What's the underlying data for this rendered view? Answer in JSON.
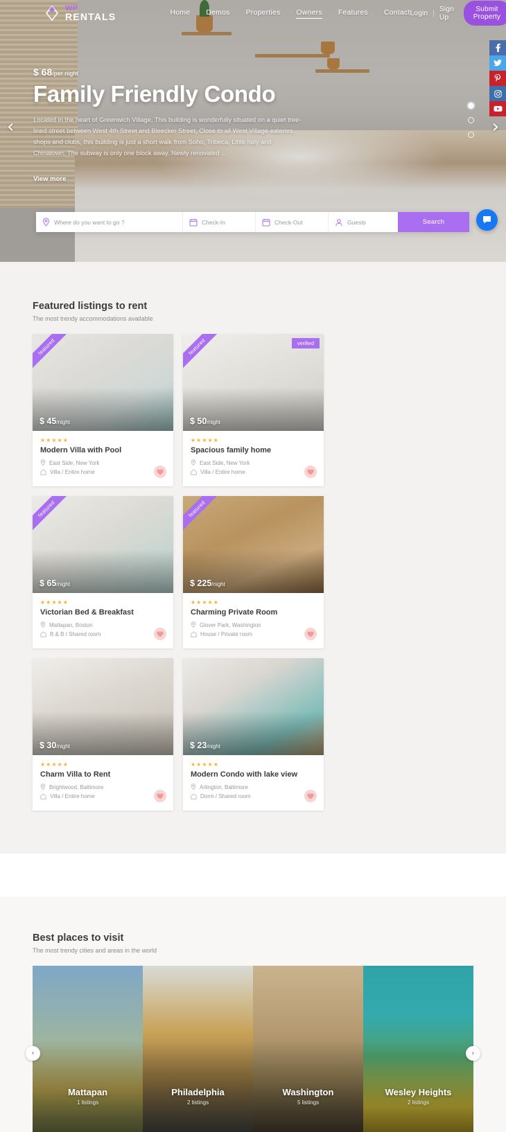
{
  "header": {
    "logo_wp": "WP",
    "logo_rentals": "RENTALS",
    "nav": [
      {
        "label": "Home",
        "active": false
      },
      {
        "label": "Demos",
        "active": false
      },
      {
        "label": "Properties",
        "active": false
      },
      {
        "label": "Owners",
        "active": true
      },
      {
        "label": "Features",
        "active": false
      },
      {
        "label": "Contact",
        "active": false
      }
    ],
    "login_label": "Login",
    "separator": "|",
    "signup_label": "Sign Up",
    "submit_label": "Submit Property"
  },
  "hero": {
    "price": "$ 68",
    "price_unit": "/per night",
    "title": "Family Friendly Condo",
    "description": "Located in the heart of Greenwich Village, This building is wonderfully situated on a quiet tree-lined street between West 4th Street and Bleecker Street, Close to all West Village eateries, shops and clubs, this building is just a short walk from Soho, Tribeca, Little Italy and Chinatown. The subway is only one block away. Newly renovated ...",
    "view_more": "View more",
    "prev_arrow": "‹",
    "next_arrow": "›",
    "slides": 3,
    "active_slide": 0
  },
  "search": {
    "location_placeholder": "Where do you want to go ?",
    "checkin_placeholder": "Check-In",
    "checkout_placeholder": "Check-Out",
    "guests_placeholder": "Guests",
    "search_label": "Search"
  },
  "social": [
    {
      "name": "facebook",
      "color": "#4a6ea9"
    },
    {
      "name": "twitter",
      "color": "#4aa8e8"
    },
    {
      "name": "pinterest",
      "color": "#c8232c"
    },
    {
      "name": "instagram",
      "color": "#3f6fa8"
    },
    {
      "name": "youtube",
      "color": "#c8232c"
    }
  ],
  "featured": {
    "title": "Featured listings to rent",
    "subtitle": "The most trendy accommodations available",
    "ribbon_label": "featured",
    "verified_label": "verified",
    "stars": "★★★★★",
    "cards": [
      {
        "price": "$ 45",
        "unit": "/night",
        "title": "Modern Villa with Pool",
        "location": "East Side, New York",
        "type": "Villa / Entire home",
        "ribbon": true,
        "verified": false
      },
      {
        "price": "$ 50",
        "unit": "/night",
        "title": "Spacious family home",
        "location": "East Side, New York",
        "type": "Villa / Entire home",
        "ribbon": true,
        "verified": true
      },
      {
        "price": "$ 65",
        "unit": "/night",
        "title": "Victorian Bed & Breakfast",
        "location": "Mattapan, Boston",
        "type": "B & B / Shared room",
        "ribbon": true,
        "verified": false
      },
      {
        "price": "$ 225",
        "unit": "/night",
        "title": "Charming Private Room",
        "location": "Glover Park, Washington",
        "type": "House / Private room",
        "ribbon": true,
        "verified": false
      },
      {
        "price": "$ 30",
        "unit": "/night",
        "title": "Charm Villa to Rent",
        "location": "Brightwood, Baltimore",
        "type": "Villa / Entire home",
        "ribbon": false,
        "verified": false
      },
      {
        "price": "$ 23",
        "unit": "/night",
        "title": "Modern Condo with lake view",
        "location": "Arlington, Baltimore",
        "type": "Dorm / Shared room",
        "ribbon": false,
        "verified": false
      }
    ]
  },
  "places": {
    "title": "Best places to visit",
    "subtitle": "The most trendy cities and areas in the world",
    "prev_arrow": "‹",
    "next_arrow": "›",
    "cities": [
      {
        "name": "Mattapan",
        "count": "1 listings"
      },
      {
        "name": "Philadelphia",
        "count": "2 listings"
      },
      {
        "name": "Washington",
        "count": "5 listings"
      },
      {
        "name": "Wesley Heights",
        "count": "2 listings"
      }
    ]
  },
  "colors": {
    "accent": "#a96ff0",
    "accent_button": "#9b51e0",
    "star": "#f5b436",
    "chat": "#1877f2",
    "section_bg": "#f4f2f0"
  }
}
